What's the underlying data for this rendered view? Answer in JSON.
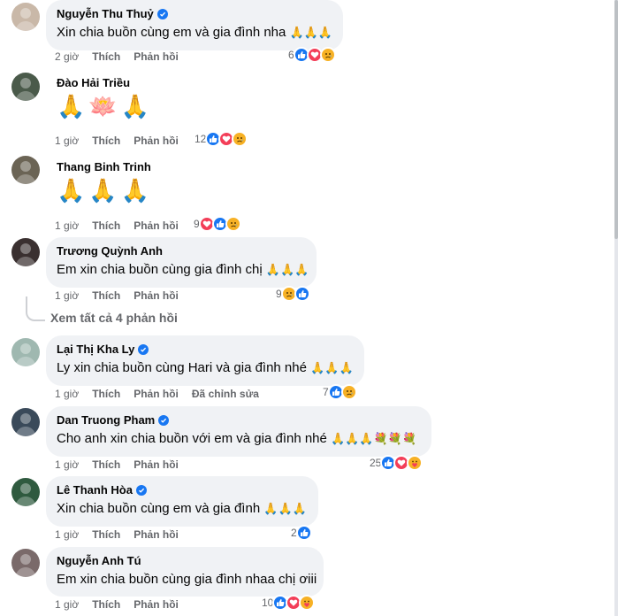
{
  "labels": {
    "like": "Thích",
    "reply": "Phản hồi"
  },
  "comments": [
    {
      "name": "Nguyễn Thu Thuỷ",
      "verified": true,
      "text": "Xin chia buồn cùng em và gia đình nha",
      "trail": "🙏🙏🙏",
      "time": "2 giờ",
      "count": "6",
      "reactions": [
        "like-icon",
        "love-icon",
        "sad-icon"
      ],
      "avatar": "#c9b8a8"
    },
    {
      "name": "Đào Hải Triều",
      "verified": false,
      "text": "",
      "trail": "🙏🪷🙏",
      "time": "1 giờ",
      "count": "12",
      "reactions": [
        "like-icon",
        "love-icon",
        "sad-icon"
      ],
      "avatar": "#4a5a4a"
    },
    {
      "name": "Thang Binh Trinh",
      "verified": false,
      "text": "",
      "trail": "🙏🙏🙏",
      "time": "1 giờ",
      "count": "9",
      "reactions": [
        "love-icon",
        "like-icon",
        "sad-icon"
      ],
      "avatar": "#6b6455"
    },
    {
      "name": "Trương Quỳnh Anh",
      "verified": false,
      "text": "Em xin chia buồn cùng gia đình chị",
      "trail": "🙏🙏🙏",
      "time": "1 giờ",
      "count": "9",
      "reactions": [
        "sad-icon",
        "like-icon"
      ],
      "avatar": "#3a3030"
    },
    {
      "name": "Lại Thị Kha Ly",
      "verified": true,
      "text": "Ly xin chia buồn cùng Hari và gia đình nhé",
      "trail": "🙏🙏🙏",
      "time": "1 giờ",
      "edited": "Đã chỉnh sửa",
      "count": "7",
      "reactions": [
        "like-icon",
        "sad-icon"
      ],
      "avatar": "#9fb8b0"
    },
    {
      "name": "Dan Truong Pham",
      "verified": true,
      "text": "Cho anh xin chia buồn với em và gia đình nhé",
      "trail": "🙏🙏🙏💐💐💐",
      "time": "1 giờ",
      "count": "25",
      "reactions": [
        "like-icon",
        "love-icon",
        "care-icon"
      ],
      "avatar": "#3a4a5a"
    },
    {
      "name": "Lê Thanh Hòa",
      "verified": true,
      "text": "Xin chia buồn cùng em và gia đình",
      "trail": "🙏🙏🙏",
      "time": "1 giờ",
      "count": "2",
      "reactions": [
        "like-icon"
      ],
      "avatar": "#2f5a3f"
    },
    {
      "name": "Nguyễn Anh Tú",
      "verified": false,
      "text": "Em xin chia buồn cùng gia đình nhaa chị ơiii",
      "trail": "",
      "time": "1 giờ",
      "count": "10",
      "reactions": [
        "like-icon",
        "love-icon",
        "care-icon"
      ],
      "avatar": "#7a6a6a"
    }
  ],
  "view_replies": "Xem tất cả 4 phản hồi"
}
